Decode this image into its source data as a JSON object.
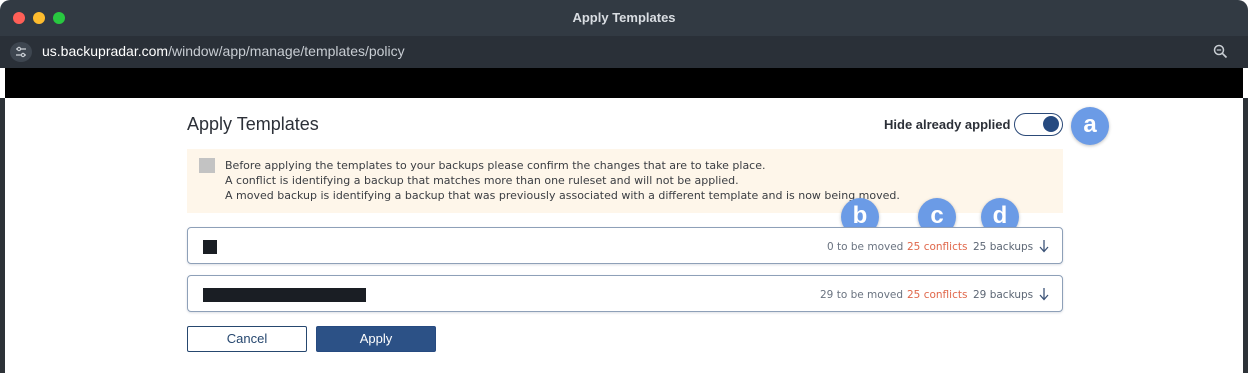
{
  "window": {
    "title": "Apply Templates",
    "url_host": "us.backupradar.com",
    "url_path": "/window/app/manage/templates/policy"
  },
  "header": {
    "title": "Apply Templates",
    "toggle_label": "Hide already applied",
    "toggle_on": true
  },
  "notice": {
    "lines": [
      "Before applying the templates to your backups please confirm the changes that are to take place.",
      "A conflict is identifying a backup that matches more than one ruleset and will not be applied.",
      "A moved backup is identifying a backup that was previously associated with a different template and is now being moved."
    ]
  },
  "rows": [
    {
      "moved": "0 to be moved",
      "conflicts": "25 conflicts",
      "backups": "25 backups"
    },
    {
      "moved": "29 to be moved",
      "conflicts": "25 conflicts",
      "backups": "29 backups"
    }
  ],
  "callouts": {
    "a": "a",
    "b": "b",
    "c": "c",
    "d": "d"
  },
  "buttons": {
    "cancel": "Cancel",
    "apply": "Apply"
  },
  "icons": {
    "site": "site-settings-icon",
    "zoom": "zoom-icon",
    "expand": "arrow-down-icon"
  },
  "colors": {
    "accent": "#2c5186",
    "conflict": "#e0674a",
    "callout": "#6b9be6",
    "notice_bg": "#fef6ea"
  }
}
